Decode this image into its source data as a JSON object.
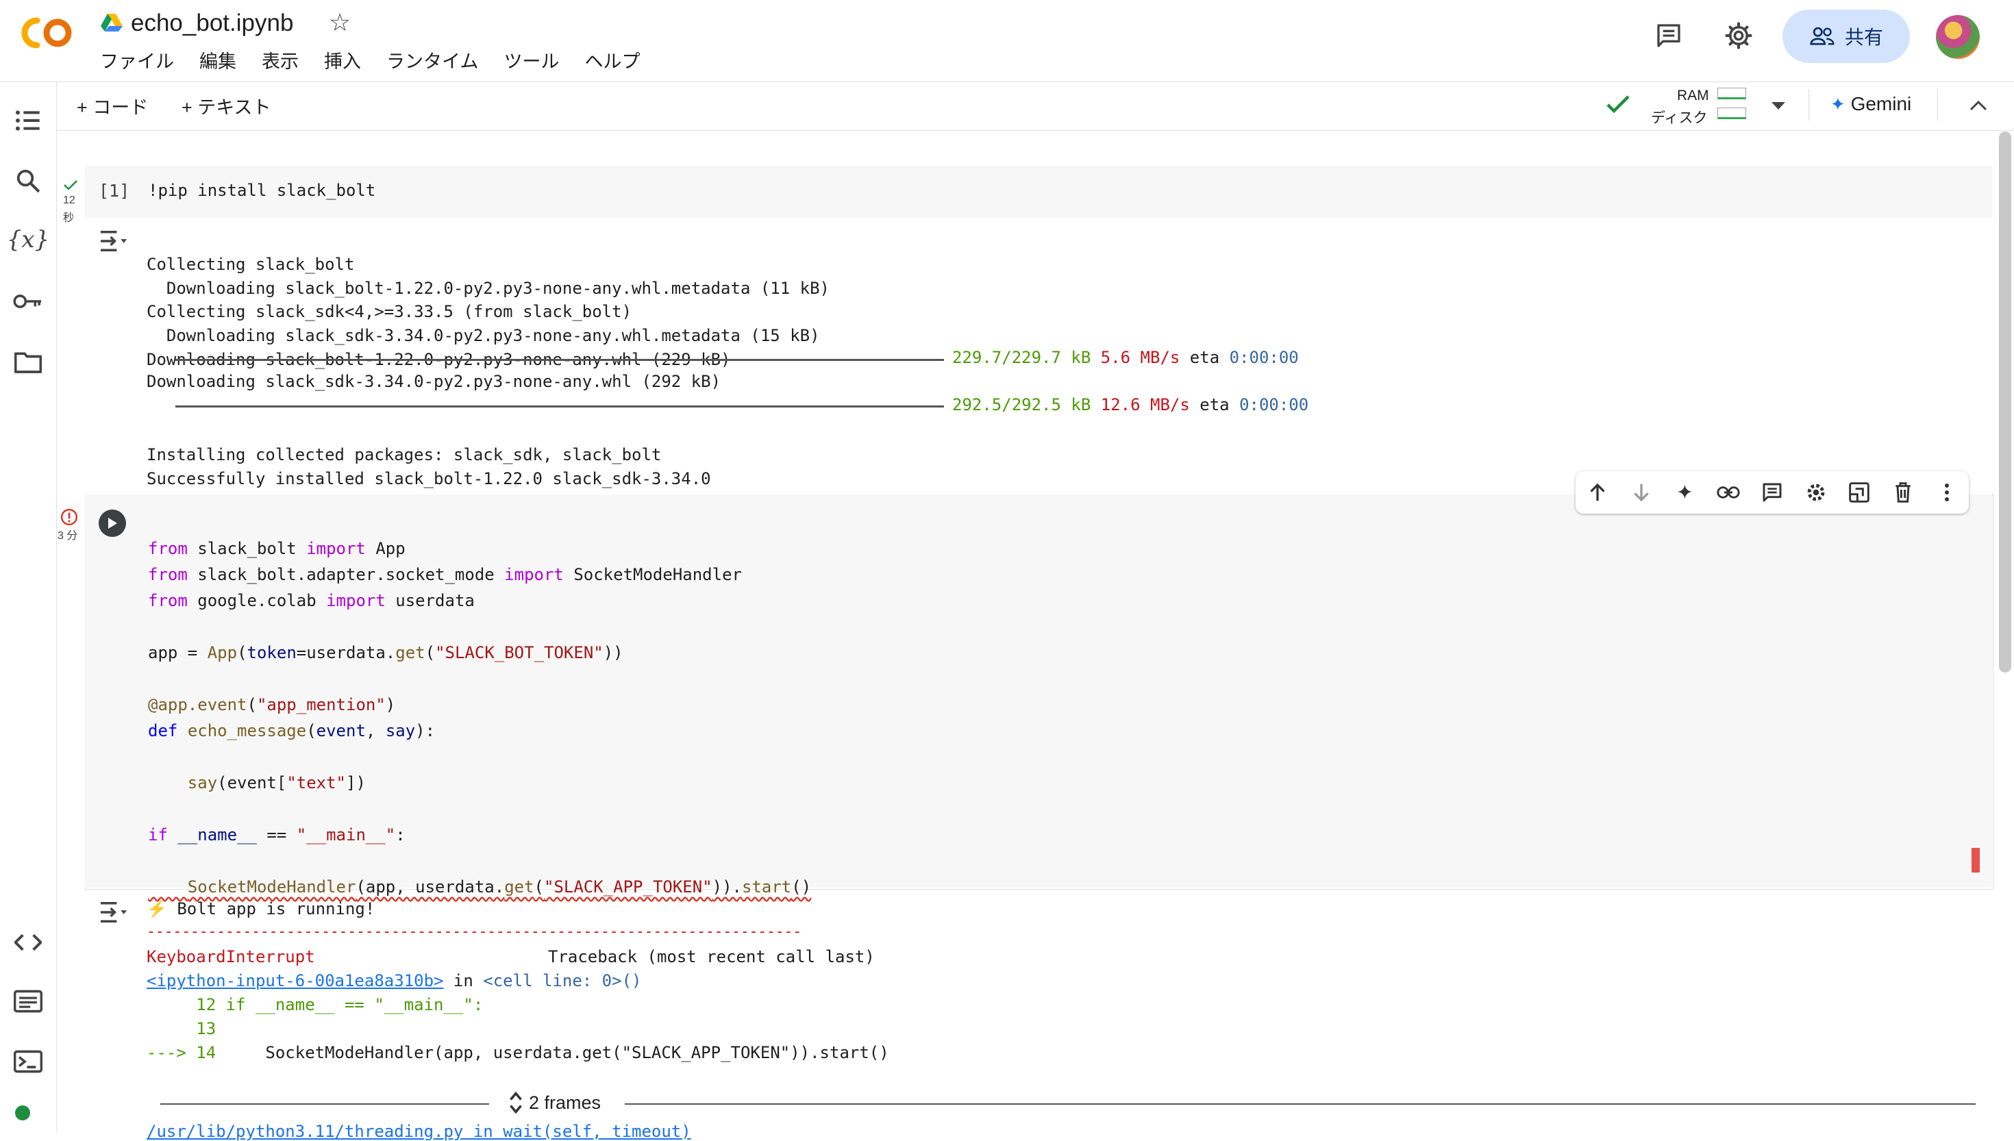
{
  "header": {
    "doc_title": "echo_bot.ipynb",
    "logo_text": "CO",
    "menu": [
      "ファイル",
      "編集",
      "表示",
      "挿入",
      "ランタイム",
      "ツール",
      "ヘルプ"
    ],
    "share_label": "共有"
  },
  "toolbar": {
    "add_code": "+ コード",
    "add_text": "+ テキスト",
    "ram_label": "RAM",
    "disk_label": "ディスク",
    "gemini_label": "Gemini"
  },
  "cell1": {
    "exec_count": "[1]",
    "exec_time": "12",
    "exec_unit": "秒",
    "code": "!pip install slack_bolt",
    "output": [
      "Collecting slack_bolt",
      "  Downloading slack_bolt-1.22.0-py2.py3-none-any.whl.metadata (11 kB)",
      "Collecting slack_sdk<4,>=3.33.5 (from slack_bolt)",
      "  Downloading slack_sdk-3.34.0-py2.py3-none-any.whl.metadata (15 kB)",
      "Downloading slack_bolt-1.22.0-py2.py3-none-any.whl (229 kB)"
    ],
    "progress1": {
      "size": "229.7/229.7 kB",
      "rate": "5.6 MB/s",
      "eta_label": "eta",
      "eta": "0:00:00",
      "fraction": 1.0
    },
    "download2": "Downloading slack_sdk-3.34.0-py2.py3-none-any.whl (292 kB)",
    "progress2": {
      "size": "292.5/292.5 kB",
      "rate": "12.6 MB/s",
      "eta_label": "eta",
      "eta": "0:00:00",
      "fraction": 1.0
    },
    "output_tail": [
      "Installing collected packages: slack_sdk, slack_bolt",
      "Successfully installed slack_bolt-1.22.0 slack_sdk-3.34.0"
    ]
  },
  "cell2": {
    "exec_time": "3 分",
    "code_lines": [
      "from slack_bolt import App",
      "from slack_bolt.adapter.socket_mode import SocketModeHandler",
      "from google.colab import userdata",
      "",
      "app = App(token=userdata.get(\"SLACK_BOT_TOKEN\"))",
      "",
      "@app.event(\"app_mention\")",
      "def echo_message(event, say):",
      "",
      "    say(event[\"text\"])",
      "",
      "if __name__ == \"__main__\":",
      "",
      "    SocketModeHandler(app, userdata.get(\"SLACK_APP_TOKEN\")).start()"
    ],
    "output": {
      "running": "⚡️ Bolt app is running!",
      "separator": "---------------------------------------------------------------------------",
      "error_name": "KeyboardInterrupt",
      "traceback_label": "Traceback (most recent call last)",
      "input_link": "<ipython-input-6-00a1ea8a310b>",
      "in_text": " in ",
      "cell_line": "<cell line: 0>",
      "parens": "()",
      "tb_line12": "     12 if __name__ == \"__main__\":",
      "tb_line13": "     13",
      "tb_arrow": "---> 14",
      "tb_line14": "     SocketModeHandler(app, userdata.get(\"SLACK_APP_TOKEN\")).start()",
      "frames_label": "2 frames",
      "cut_line": "/usr/lib/python3.11/threading.py in wait(self, timeout)"
    }
  },
  "colors": {
    "accent_blue": "#1a73e8",
    "success_green": "#34a853",
    "error_red": "#d93025",
    "share_bg": "#d3e3fd"
  }
}
